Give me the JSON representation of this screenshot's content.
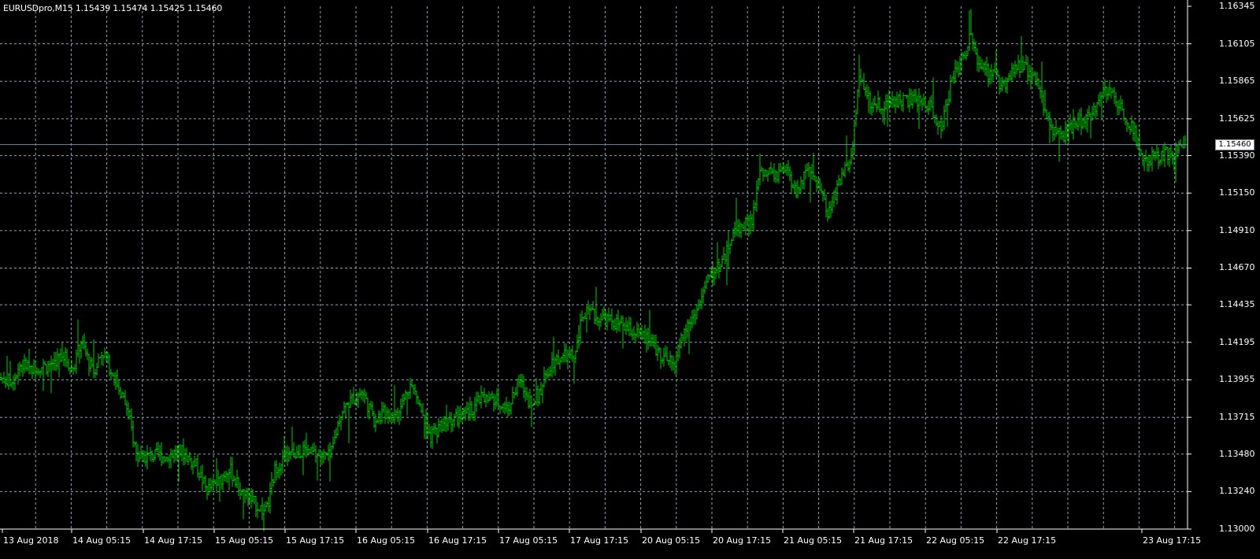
{
  "chart_window": {
    "header": "EURUSDpro,M15  1.15439 1.15474 1.15425 1.15460",
    "current_price_label": "1.15460"
  },
  "colors": {
    "background": "#000000",
    "grid": "#94a3b3",
    "bars": "#00cc00",
    "axis": "#ffffff",
    "bid_line": "#7a8a9a"
  },
  "chart_data": {
    "type": "line",
    "symbol": "EURUSDpro",
    "timeframe": "M15",
    "ohlc_last": {
      "open": 1.15439,
      "high": 1.15474,
      "low": 1.15425,
      "close": 1.1546
    },
    "bid": 1.1546,
    "ylim": [
      1.13,
      1.16345
    ],
    "y_ticks": [
      "1.16345",
      "1.16105",
      "1.15865",
      "1.15625",
      "1.15390",
      "1.15150",
      "1.14910",
      "1.14670",
      "1.14435",
      "1.14195",
      "1.13955",
      "1.13715",
      "1.13480",
      "1.13240",
      "1.13000"
    ],
    "x_ticks": [
      "13 Aug 2018",
      "14 Aug 05:15",
      "14 Aug 17:15",
      "15 Aug 05:15",
      "15 Aug 17:15",
      "16 Aug 05:15",
      "16 Aug 17:15",
      "17 Aug 05:15",
      "17 Aug 17:15",
      "20 Aug 05:15",
      "20 Aug 17:15",
      "21 Aug 05:15",
      "21 Aug 17:15",
      "22 Aug 05:15",
      "22 Aug 17:15",
      "23 Aug 17:15"
    ],
    "grid": true,
    "series": [
      {
        "x": [
          "13 Aug 2018",
          "14 Aug 05:15",
          "14 Aug 17:15",
          "15 Aug 05:15",
          "15 Aug 17:15",
          "16 Aug 05:15",
          "16 Aug 17:15",
          "17 Aug 05:15",
          "17 Aug 17:15",
          "20 Aug 05:15",
          "20 Aug 17:15",
          "21 Aug 05:15",
          "21 Aug 17:15",
          "22 Aug 05:15",
          "22 Aug 17:15",
          "23 Aug 17:15"
        ],
        "values": [
          1.1395,
          1.141,
          1.1345,
          1.1322,
          1.1346,
          1.138,
          1.138,
          1.1382,
          1.142,
          1.1404,
          1.153,
          1.152,
          1.1572,
          1.1595,
          1.159,
          1.1543
        ]
      }
    ]
  }
}
